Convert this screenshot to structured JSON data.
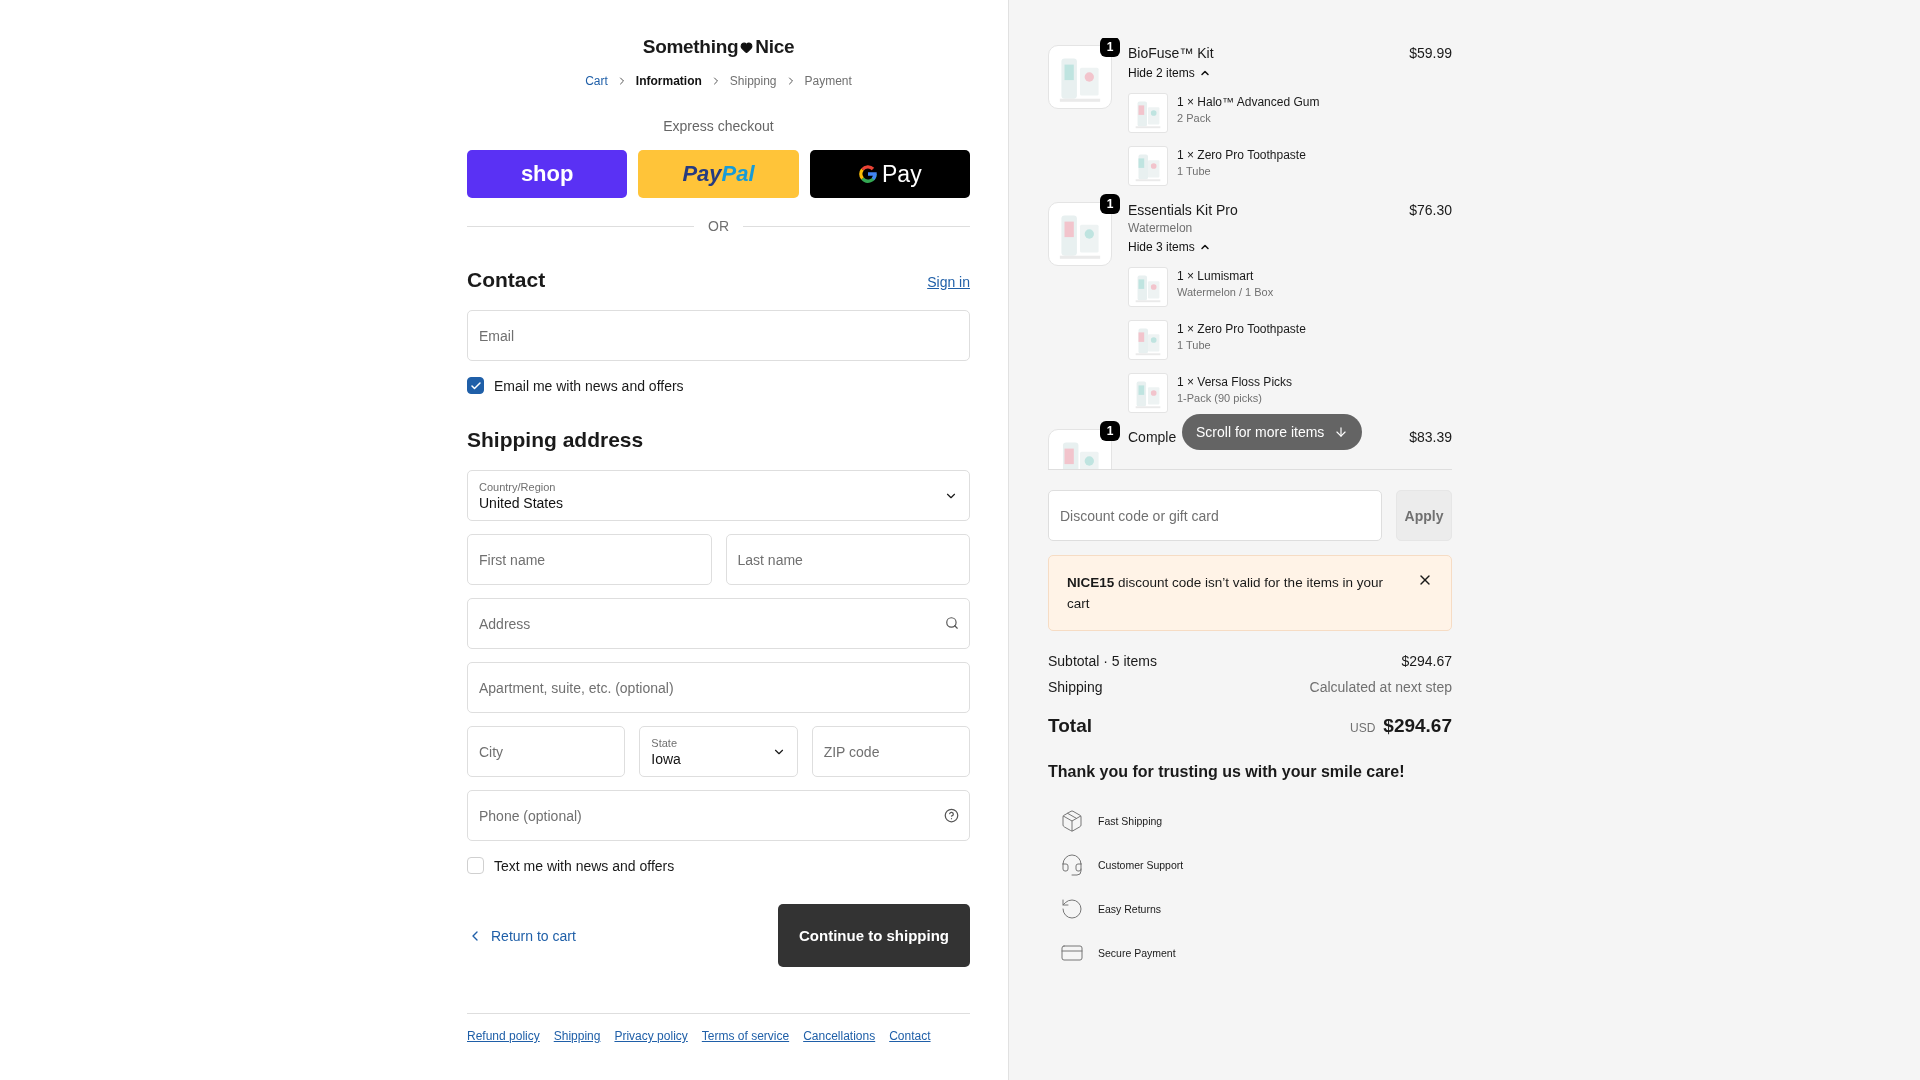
{
  "header": {
    "logo": [
      "Something",
      "Nice"
    ],
    "breadcrumbs": [
      {
        "label": "Cart",
        "selected": false,
        "completed": true
      },
      {
        "label": "Information",
        "selected": true,
        "completed": false
      },
      {
        "label": "Shipping",
        "selected": false,
        "completed": false
      },
      {
        "label": "Payment",
        "selected": false,
        "completed": false
      }
    ]
  },
  "express": {
    "title": "Express checkout",
    "divider": "OR",
    "buttons": [
      {
        "kind": "shop",
        "label": "shop"
      },
      {
        "kind": "paypal",
        "label": "Pay",
        "label2": "Pal"
      },
      {
        "kind": "gpay",
        "label": "Pay"
      }
    ]
  },
  "contact": {
    "title": "Contact",
    "link": "Sign in",
    "field": {
      "kind": "text",
      "placeholder": "Email"
    },
    "checkbox": {
      "label": "Email me with news and offers",
      "checked": true
    }
  },
  "shipping": {
    "title": "Shipping address",
    "rows": [
      [
        {
          "kind": "select",
          "label": "Country/Region",
          "value": "United States"
        }
      ],
      [
        {
          "kind": "text",
          "placeholder": "First name"
        },
        {
          "kind": "text",
          "placeholder": "Last name"
        }
      ],
      [
        {
          "kind": "search",
          "placeholder": "Address"
        }
      ],
      [
        {
          "kind": "text",
          "placeholder": "Apartment, suite, etc. (optional)"
        }
      ],
      [
        {
          "kind": "text",
          "placeholder": "City"
        },
        {
          "kind": "select",
          "label": "State",
          "value": "Iowa"
        },
        {
          "kind": "text",
          "placeholder": "ZIP code"
        }
      ],
      [
        {
          "kind": "help",
          "placeholder": "Phone (optional)"
        }
      ]
    ],
    "checkbox": {
      "label": "Text me with news and offers",
      "checked": false
    }
  },
  "actions": {
    "back": "Return to cart",
    "continue": "Continue to shipping"
  },
  "footer_links": [
    "Refund policy",
    "Shipping",
    "Privacy policy",
    "Terms of service",
    "Cancellations",
    "Contact"
  ],
  "summary": {
    "items": [
      {
        "quantity": "1",
        "name": "BioFuse™ Kit",
        "price": "$59.99",
        "toggle": "Hide 2 items",
        "expanded": true,
        "components": [
          {
            "name": "1 × Halo™ Advanced Gum",
            "variant": "2 Pack"
          },
          {
            "name": "1 × Zero Pro Toothpaste",
            "variant": "1 Tube"
          }
        ]
      },
      {
        "quantity": "1",
        "name": "Essentials Kit Pro",
        "variant": "Watermelon",
        "price": "$76.30",
        "toggle": "Hide 3 items",
        "expanded": true,
        "components": [
          {
            "name": "1 × Lumismart",
            "variant": "Watermelon / 1 Box"
          },
          {
            "name": "1 × Zero Pro Toothpaste",
            "variant": "1 Tube"
          },
          {
            "name": "1 × Versa Floss Picks",
            "variant": "1-Pack (90 picks)"
          }
        ]
      },
      {
        "quantity": "1",
        "name": "Comple",
        "price": "$83.39"
      }
    ],
    "scroll_hint": "Scroll for more items",
    "discount": {
      "placeholder": "Discount code or gift card",
      "button": "Apply"
    },
    "alert": "**NICE15** discount code isn’t valid for the items in your cart",
    "subtotal_label": "Subtotal · 5 items",
    "subtotal": "$294.67",
    "shipping_label": "Shipping",
    "shipping_value": "Calculated at next step",
    "total_label": "Total",
    "currency": "USD",
    "total": "$294.67",
    "thanks": "Thank you for trusting us with your smile care!",
    "perks": [
      {
        "kind": "shipping",
        "label": "Fast Shipping"
      },
      {
        "kind": "support",
        "label": "Customer Support"
      },
      {
        "kind": "returns",
        "label": "Easy Returns"
      },
      {
        "kind": "payment",
        "label": "Secure Payment"
      }
    ]
  }
}
